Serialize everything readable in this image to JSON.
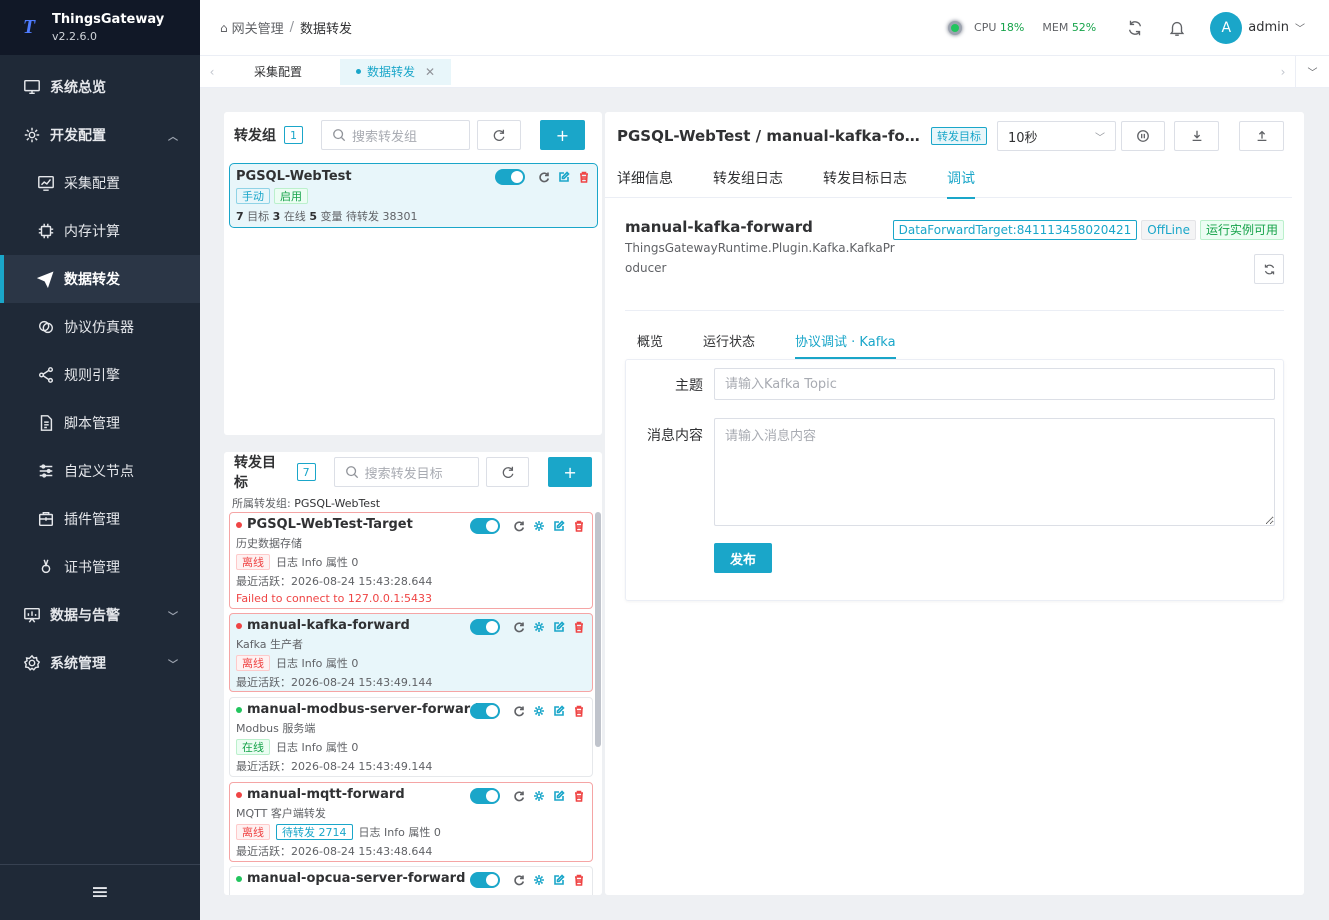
{
  "app": {
    "name": "ThingsGateway",
    "version": "v2.2.6.0",
    "logo_letter": "T"
  },
  "sidebar": {
    "items": [
      {
        "label": "系统总览",
        "icon": "monitor-icon"
      },
      {
        "label": "开发配置",
        "icon": "gear-icon"
      },
      {
        "label": "采集配置",
        "icon": "chart-icon"
      },
      {
        "label": "内存计算",
        "icon": "cpu-icon"
      },
      {
        "label": "数据转发",
        "icon": "send-icon"
      },
      {
        "label": "协议仿真器",
        "icon": "link-icon"
      },
      {
        "label": "规则引擎",
        "icon": "share-icon"
      },
      {
        "label": "脚本管理",
        "icon": "file-icon"
      },
      {
        "label": "自定义节点",
        "icon": "sliders-icon"
      },
      {
        "label": "插件管理",
        "icon": "package-icon"
      },
      {
        "label": "证书管理",
        "icon": "certificate-icon"
      },
      {
        "label": "数据与告警",
        "icon": "presentation-icon"
      },
      {
        "label": "系统管理",
        "icon": "settings-icon"
      }
    ],
    "footer_icon": "menu-icon"
  },
  "header": {
    "breadcrumb": [
      "网关管理",
      "数据转发"
    ],
    "cpu_label": "CPU",
    "cpu_value": "18%",
    "mem_label": "MEM",
    "mem_value": "52%",
    "user_initial": "A",
    "user_name": "admin"
  },
  "page_tabs": [
    {
      "label": "采集配置",
      "active": false
    },
    {
      "label": "数据转发",
      "active": true
    }
  ],
  "groups": {
    "title": "转发组",
    "count": "1",
    "search_placeholder": "搜索转发组",
    "card": {
      "name": "PGSQL-WebTest",
      "tag_mode": "手动",
      "tag_state": "启用",
      "targets_num": "7",
      "targets_label": "目标",
      "online_num": "3",
      "online_label": "在线",
      "vars_num": "5",
      "vars_label": "变量",
      "pending_label": "待转发",
      "pending_num": "38301"
    }
  },
  "targets": {
    "title": "转发目标",
    "count": "7",
    "search_placeholder": "搜索转发目标",
    "belong_label": "所属转发组:",
    "belong_value": "PGSQL-WebTest",
    "items": [
      {
        "name": "PGSQL-WebTest-Target",
        "desc": "历史数据存储",
        "status": "离线",
        "pending": "",
        "log": "日志 Info",
        "attr": "属性 0",
        "active": "最近活跃：2026-08-24 15:43:28.644",
        "error": "Failed to connect to 127.0.0.1:5433"
      },
      {
        "name": "manual-kafka-forward",
        "desc": "Kafka 生产者",
        "status": "离线",
        "pending": "",
        "log": "日志 Info",
        "attr": "属性 0",
        "active": "最近活跃：2026-08-24 15:43:49.144",
        "error": ""
      },
      {
        "name": "manual-modbus-server-forward",
        "desc": "Modbus 服务端",
        "status": "在线",
        "pending": "",
        "log": "日志 Info",
        "attr": "属性 0",
        "active": "最近活跃：2026-08-24 15:43:49.144",
        "error": ""
      },
      {
        "name": "manual-mqtt-forward",
        "desc": "MQTT 客户端转发",
        "status": "离线",
        "pending": "待转发 2714",
        "log": "日志 Info",
        "attr": "属性 0",
        "active": "最近活跃：2026-08-24 15:43:48.644",
        "error": ""
      },
      {
        "name": "manual-opcua-server-forward",
        "desc": "",
        "status": "",
        "pending": "",
        "log": "",
        "attr": "",
        "active": "",
        "error": ""
      }
    ]
  },
  "detail": {
    "title": "PGSQL-WebTest / manual-kafka-forward",
    "badge": "转发目标",
    "interval": "10秒",
    "tabs": [
      "详细信息",
      "转发组日志",
      "转发目标日志",
      "调试"
    ],
    "target": {
      "name": "manual-kafka-forward",
      "class": "ThingsGatewayRuntime.Plugin.Kafka.KafkaProducer",
      "id_tag": "DataForwardTarget:841113458020421",
      "state_tag": "OffLine",
      "runtime_tag": "运行实例可用"
    },
    "sub_tabs": [
      "概览",
      "运行状态",
      "协议调试 · Kafka"
    ],
    "form": {
      "topic_label": "主题",
      "topic_placeholder": "请输入Kafka Topic",
      "topic_value": "",
      "msg_label": "消息内容",
      "msg_placeholder": "请输入消息内容",
      "msg_value": "",
      "publish": "发布"
    }
  }
}
